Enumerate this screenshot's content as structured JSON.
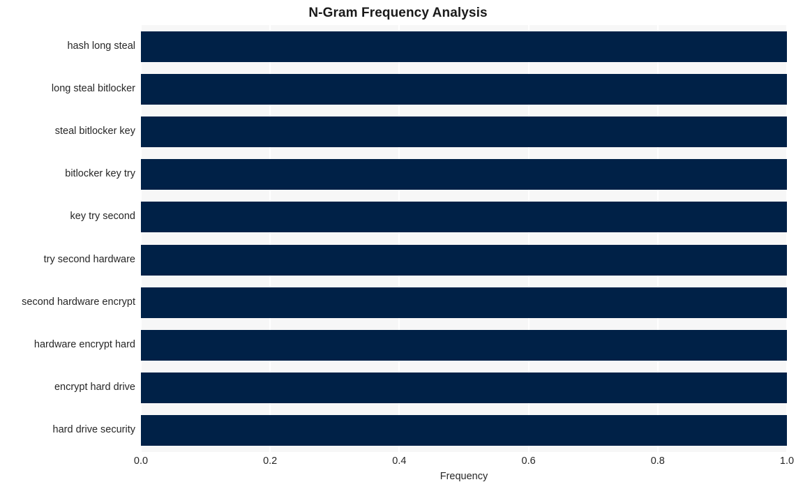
{
  "chart_data": {
    "type": "bar",
    "orientation": "horizontal",
    "title": "N-Gram Frequency Analysis",
    "xlabel": "Frequency",
    "ylabel": "",
    "categories": [
      "hash long steal",
      "long steal bitlocker",
      "steal bitlocker key",
      "bitlocker key try",
      "key try second",
      "try second hardware",
      "second hardware encrypt",
      "hardware encrypt hard",
      "encrypt hard drive",
      "hard drive security"
    ],
    "values": [
      1.0,
      1.0,
      1.0,
      1.0,
      1.0,
      1.0,
      1.0,
      1.0,
      1.0,
      1.0
    ],
    "xlim": [
      0.0,
      1.0
    ],
    "xticks": [
      0.0,
      0.2,
      0.4,
      0.6,
      0.8,
      1.0
    ],
    "xtick_labels": [
      "0.0",
      "0.2",
      "0.4",
      "0.6",
      "0.8",
      "1.0"
    ],
    "grid": true,
    "grid_color": "#ffffff",
    "legend": null,
    "bar_color": "#002147",
    "plot_background": "#f7f7f7",
    "figure_background": "#ffffff"
  }
}
